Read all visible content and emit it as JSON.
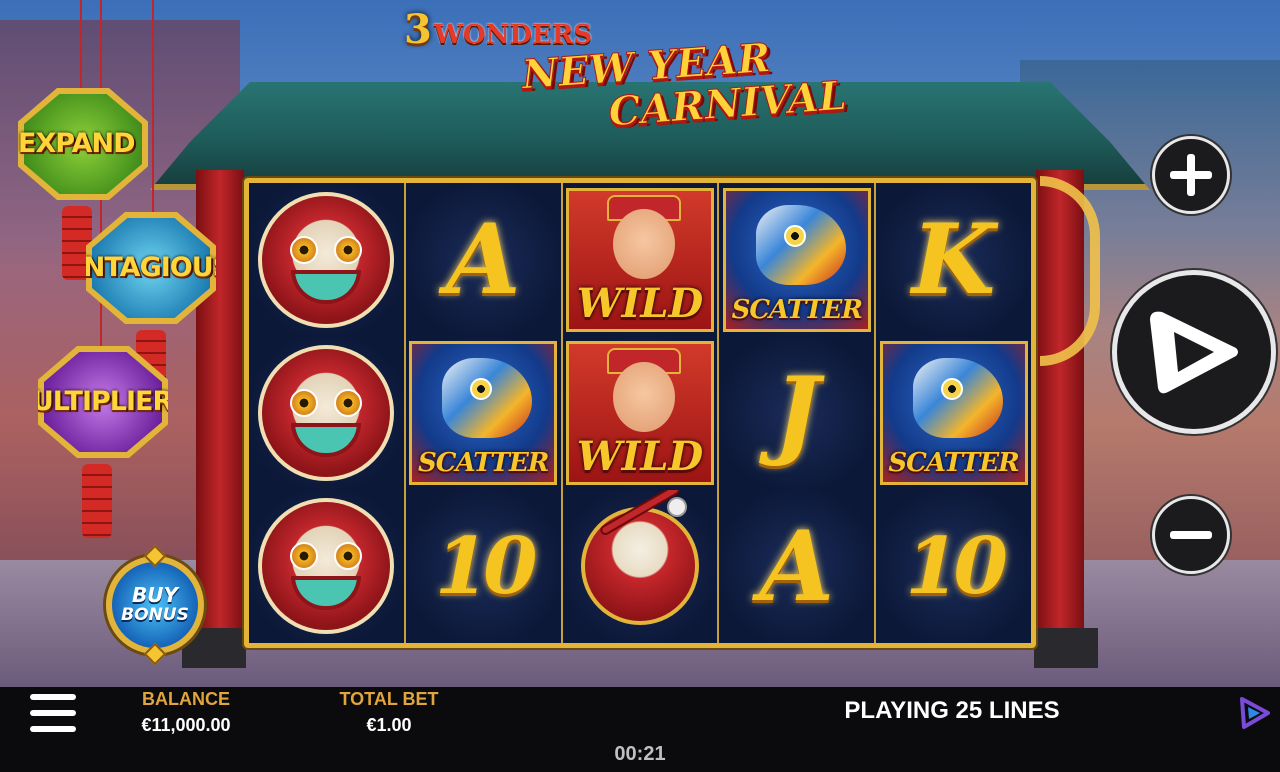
{
  "game": {
    "brand": "3 WONDERS",
    "brand_number": "3",
    "brand_word": "WONDERS",
    "title_line1": "NEW YEAR",
    "title_line2": "CARNIVAL"
  },
  "features": {
    "expand": "EXPAND",
    "contagious": "CONTAGIOUS",
    "multiplier": "MULTIPLIER"
  },
  "buy_bonus": {
    "line1": "BUY",
    "line2": "BONUS"
  },
  "reels": [
    [
      {
        "type": "lion"
      },
      {
        "type": "lion"
      },
      {
        "type": "lion"
      }
    ],
    [
      {
        "type": "letter",
        "text": "A"
      },
      {
        "type": "scatter",
        "label": "SCATTER"
      },
      {
        "type": "letter",
        "text": "10"
      }
    ],
    [
      {
        "type": "wild",
        "label": "WILD"
      },
      {
        "type": "wild",
        "label": "WILD"
      },
      {
        "type": "drum"
      }
    ],
    [
      {
        "type": "scatter",
        "label": "SCATTER"
      },
      {
        "type": "letter",
        "text": "J"
      },
      {
        "type": "letter",
        "text": "A"
      }
    ],
    [
      {
        "type": "letter",
        "text": "K"
      },
      {
        "type": "scatter",
        "label": "SCATTER"
      },
      {
        "type": "letter",
        "text": "10"
      }
    ]
  ],
  "controls": {
    "plus_icon": "plus-icon",
    "spin_icon": "spin-play-icon",
    "minus_icon": "minus-icon"
  },
  "bottom_bar": {
    "balance_label": "BALANCE",
    "balance_value": "€11,000.00",
    "bet_label": "TOTAL BET",
    "bet_value": "€1.00",
    "lines_text": "PLAYING 25 LINES",
    "clock": "00:21"
  },
  "colors": {
    "gold": "#e3b43a",
    "bar_label": "#e2a43c",
    "reel_bg": "#0c1838"
  }
}
